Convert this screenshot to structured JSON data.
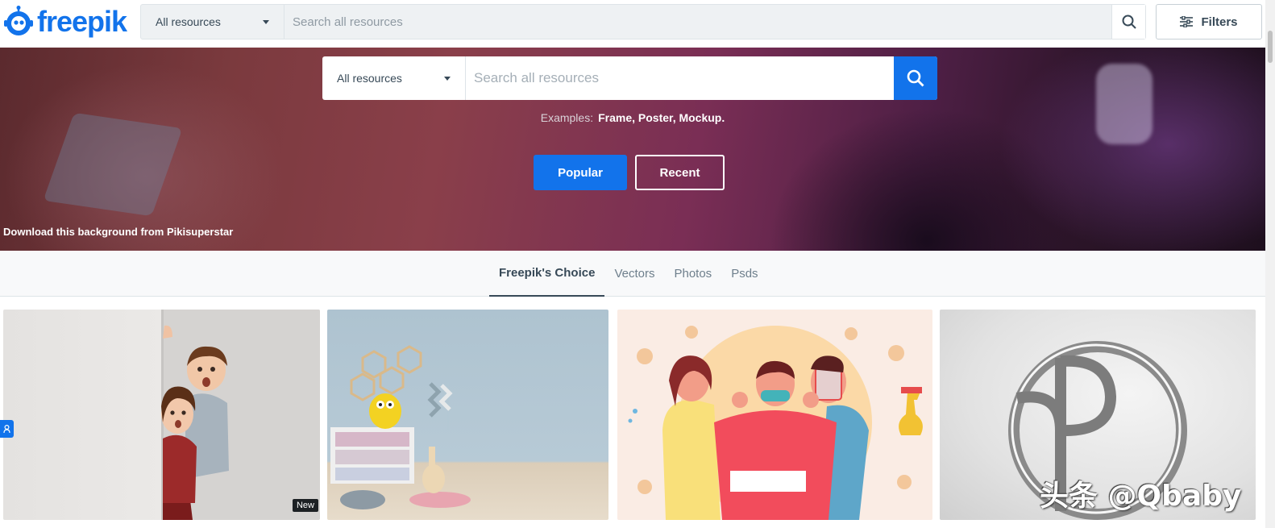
{
  "brand": {
    "name": "freepik",
    "color": "#1273eb"
  },
  "header": {
    "resource_type": "All resources",
    "search_placeholder": "Search all resources",
    "filters_label": "Filters"
  },
  "hero": {
    "resource_type": "All resources",
    "search_placeholder": "Search all resources",
    "examples_label": "Examples:",
    "examples": "Frame, Poster, Mockup.",
    "popular_label": "Popular",
    "recent_label": "Recent",
    "credit": "Download this background from Pikisuperstar"
  },
  "tabs": [
    {
      "label": "Freepik's Choice",
      "active": true
    },
    {
      "label": "Vectors",
      "active": false
    },
    {
      "label": "Photos",
      "active": false
    },
    {
      "label": "Psds",
      "active": false
    }
  ],
  "cards": [
    {
      "subject": "kids peeking behind wall photo",
      "badge": "New"
    },
    {
      "subject": "children room interior mockup"
    },
    {
      "subject": "people wearing masks hygiene illustration"
    },
    {
      "subject": "embossed logo mockup"
    }
  ],
  "watermark": "头条 @Qbaby",
  "icons": {
    "search": "search-icon",
    "filters": "sliders-icon",
    "logo": "robot-mascot-icon"
  }
}
